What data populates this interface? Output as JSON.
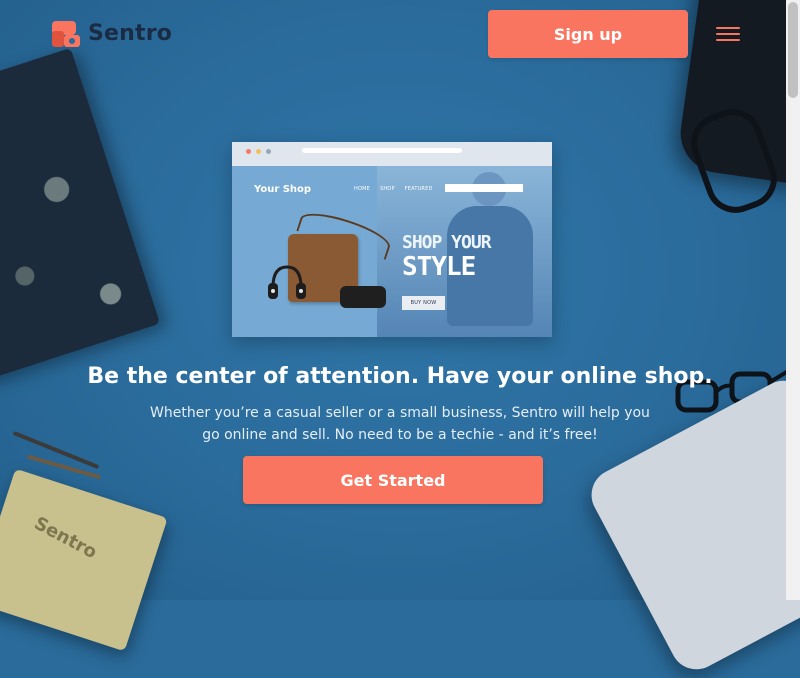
{
  "brand": {
    "name": "Sentro",
    "accent": "#fa7560",
    "background": "#2a6b9b"
  },
  "header": {
    "signup_label": "Sign up",
    "menu_icon": "hamburger-menu-icon"
  },
  "mockup": {
    "shop_name": "Your Shop",
    "nav": [
      "HOME",
      "SHOP",
      "FEATURED"
    ],
    "headline_line1": "SHOP YOUR",
    "headline_line2": "STYLE",
    "cta": "BUY NOW"
  },
  "hero": {
    "title": "Be the center of attention. Have your online shop.",
    "subtitle": "Whether you’re a casual seller or a small business, Sentro will help you go online and sell. No need to be a techie - and it’s free!",
    "cta_label": "Get Started"
  },
  "decor": {
    "notebook_text": "Sentro"
  }
}
